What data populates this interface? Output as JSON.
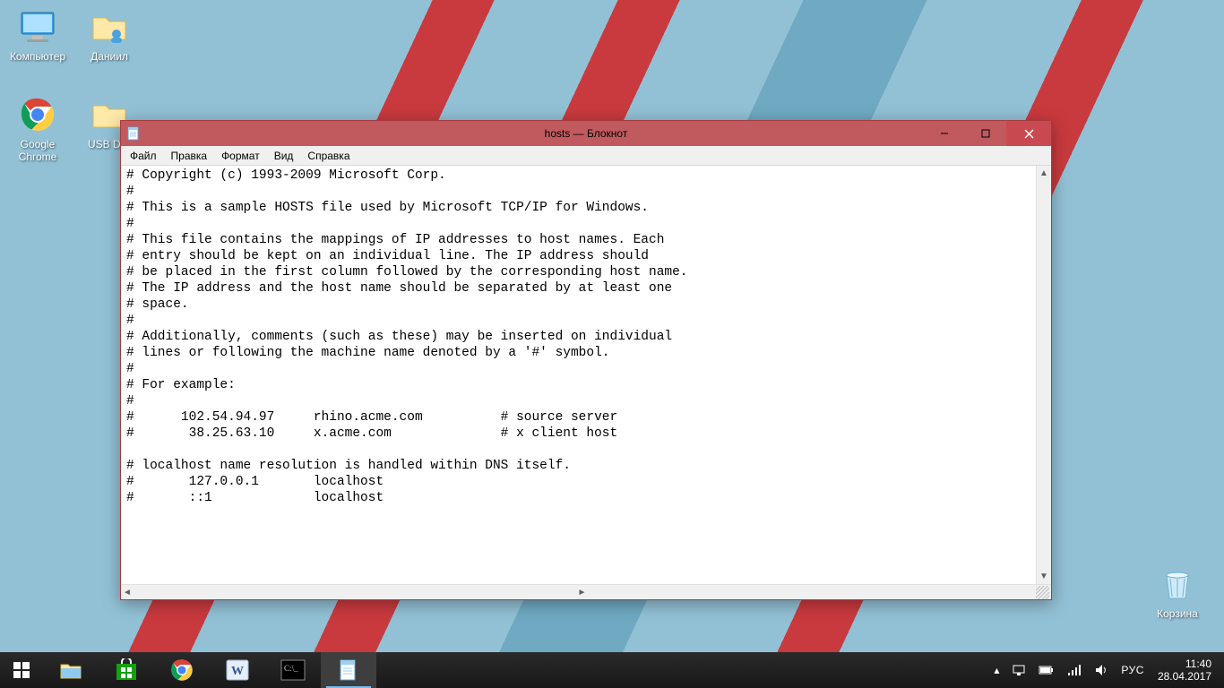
{
  "desktop": {
    "icons": [
      {
        "name": "computer-icon",
        "label": "Компьютер"
      },
      {
        "name": "user-folder-icon",
        "label": "Даниил"
      },
      {
        "name": "chrome-icon",
        "label": "Google Chrome"
      },
      {
        "name": "usb-folder-icon",
        "label": "USB DIS"
      }
    ],
    "recycle_label": "Корзина"
  },
  "notepad": {
    "title": "hosts — Блокнот",
    "menus": {
      "file": "Файл",
      "edit": "Правка",
      "format": "Формат",
      "view": "Вид",
      "help": "Справка"
    },
    "content": "# Copyright (c) 1993-2009 Microsoft Corp.\n#\n# This is a sample HOSTS file used by Microsoft TCP/IP for Windows.\n#\n# This file contains the mappings of IP addresses to host names. Each\n# entry should be kept on an individual line. The IP address should\n# be placed in the first column followed by the corresponding host name.\n# The IP address and the host name should be separated by at least one\n# space.\n#\n# Additionally, comments (such as these) may be inserted on individual\n# lines or following the machine name denoted by a '#' symbol.\n#\n# For example:\n#\n#      102.54.94.97     rhino.acme.com          # source server\n#       38.25.63.10     x.acme.com              # x client host\n\n# localhost name resolution is handled within DNS itself.\n#\t127.0.0.1       localhost\n#\t::1             localhost"
  },
  "taskbar": {
    "lang": "РУС",
    "time": "11:40",
    "date": "28.04.2017"
  }
}
